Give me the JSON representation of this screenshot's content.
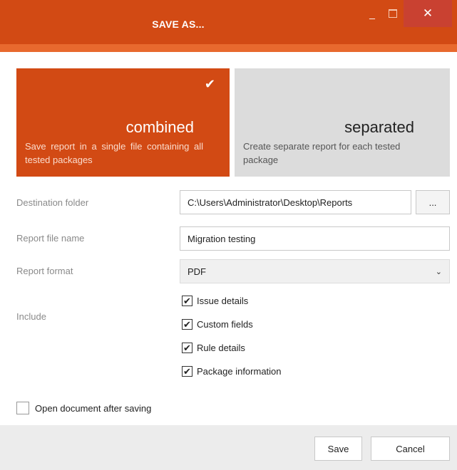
{
  "window": {
    "title": "SAVE AS...",
    "minimize_glyph": "_",
    "close_glyph": "✕"
  },
  "modes": [
    {
      "title": "combined",
      "description": "Save report in a single file containing all tested packages",
      "selected": true,
      "check_glyph": "✔"
    },
    {
      "title": "separated",
      "description": "Create separate report for each tested package",
      "selected": false
    }
  ],
  "form": {
    "destination": {
      "label": "Destination folder",
      "value": "C:\\Users\\Administrator\\Desktop\\Reports",
      "browse_label": "..."
    },
    "file_name": {
      "label": "Report file name",
      "value": "Migration testing"
    },
    "format": {
      "label": "Report format",
      "value": "PDF"
    },
    "include": {
      "label": "Include",
      "options": [
        {
          "label": "Issue details",
          "checked": true
        },
        {
          "label": "Custom fields",
          "checked": true
        },
        {
          "label": "Rule details",
          "checked": true
        },
        {
          "label": "Package information",
          "checked": true
        }
      ]
    },
    "open_after_saving": {
      "label": "Open document after saving",
      "checked": false
    }
  },
  "buttons": {
    "save": "Save",
    "cancel": "Cancel"
  },
  "icons": {
    "checkbox_checked_glyph": "✔",
    "dropdown_glyph": "⌄"
  },
  "colors": {
    "accent": "#d24a14",
    "accent_light": "#e8692e",
    "inactive_card": "#dcdcdc"
  }
}
